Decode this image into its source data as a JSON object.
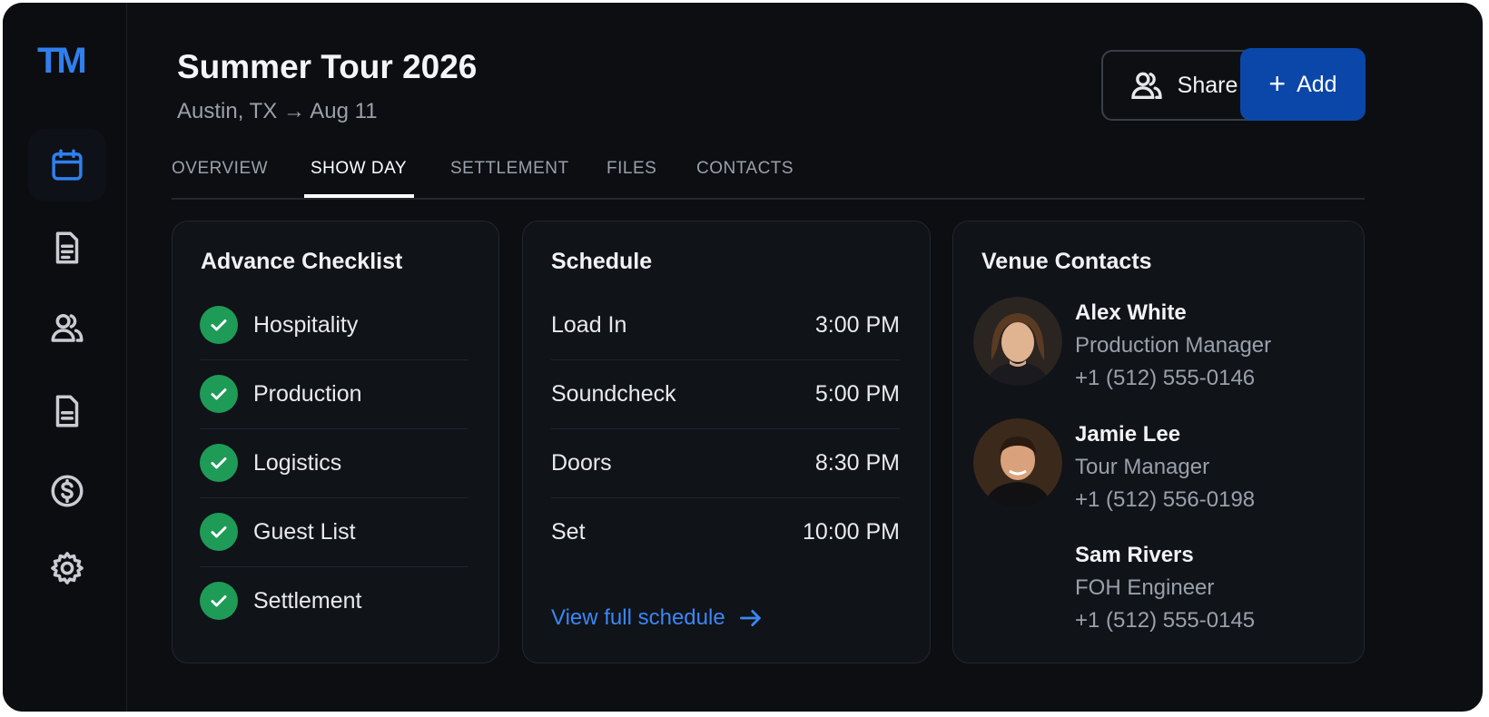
{
  "app": {
    "logo_text": "TM",
    "accent_color": "#2f80ed",
    "success_color": "#1e9b57"
  },
  "sidebar": {
    "items": [
      {
        "icon": "calendar-icon",
        "active": true
      },
      {
        "icon": "document-icon",
        "active": false
      },
      {
        "icon": "users-icon",
        "active": false
      },
      {
        "icon": "file-icon",
        "active": false
      },
      {
        "icon": "dollar-icon",
        "active": false
      },
      {
        "icon": "gear-icon",
        "active": false
      }
    ]
  },
  "header": {
    "title": "Summer Tour 2026",
    "subtitle": "Austin, TX → Aug 11",
    "share_label": "Share",
    "add_label": "Add",
    "add_icon": "+"
  },
  "tabs": [
    {
      "label": "OVERVIEW",
      "active": false
    },
    {
      "label": "SHOW DAY",
      "active": true
    },
    {
      "label": "SETTLEMENT",
      "active": false
    },
    {
      "label": "FILES",
      "active": false
    },
    {
      "label": "CONTACTS",
      "active": false
    }
  ],
  "checklist": {
    "title": "Advance Checklist",
    "items": [
      {
        "label": "Hospitality",
        "checked": true
      },
      {
        "label": "Production",
        "checked": true
      },
      {
        "label": "Logistics",
        "checked": true
      },
      {
        "label": "Guest List",
        "checked": true
      },
      {
        "label": "Settlement",
        "checked": true
      }
    ]
  },
  "schedule": {
    "title": "Schedule",
    "items": [
      {
        "label": "Load In",
        "time": "3:00 PM"
      },
      {
        "label": "Soundcheck",
        "time": "5:00 PM"
      },
      {
        "label": "Doors",
        "time": "8:30 PM"
      },
      {
        "label": "Set",
        "time": "10:00 PM"
      }
    ],
    "link_label": "View full schedule"
  },
  "contacts": {
    "title": "Venue Contacts",
    "items": [
      {
        "name": "Alex White",
        "role": "Production Manager",
        "phone": "+1 (512) 555-0146",
        "has_photo": true
      },
      {
        "name": "Jamie Lee",
        "role": "Tour Manager",
        "phone": "+1 (512) 556-0198",
        "has_photo": true
      },
      {
        "name": "Sam Rivers",
        "role": "FOH Engineer",
        "phone": "+1 (512) 555-0145",
        "has_photo": false
      }
    ]
  }
}
